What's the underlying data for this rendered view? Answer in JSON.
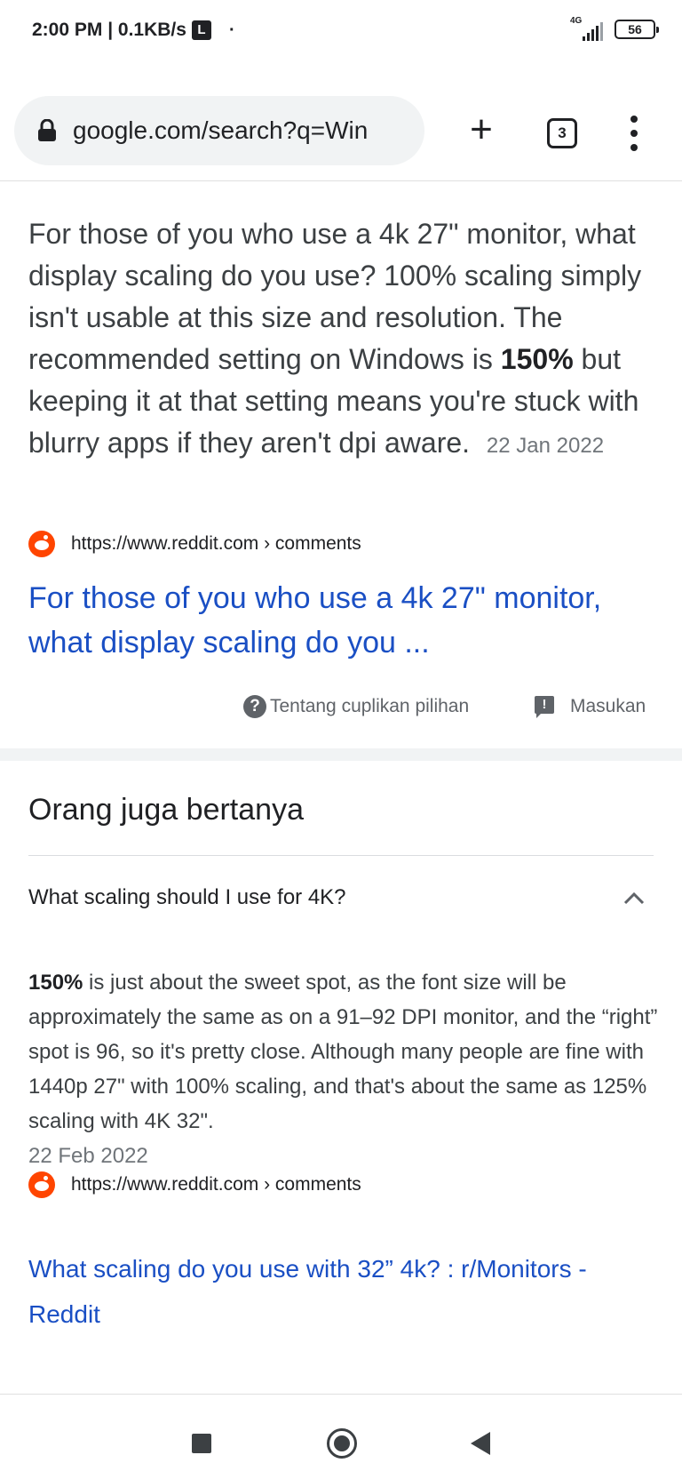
{
  "status_bar": {
    "time_speed": "2:00 PM | 0.1KB/s",
    "l_badge": "L",
    "dot": "·",
    "network": "4G",
    "battery": "56"
  },
  "browser": {
    "url": "google.com/search?q=Win",
    "plus": "+",
    "tab_count": "3"
  },
  "snippet": {
    "text_before": "For those of you who use a 4k 27\" monitor, what display scaling do you use? 100% scaling simply isn't usable at this size and resolution. The recommended setting on Windows is ",
    "bold": "150%",
    "text_after": " but keeping it at that setting means you're stuck with blurry apps if they aren't dpi aware.",
    "date": "22 Jan 2022"
  },
  "result1": {
    "source": "https://www.reddit.com › comments",
    "title": "For those of you who use a 4k 27\" monitor, what display scaling do you ..."
  },
  "feedback": {
    "about_label": "Tentang cuplikan pilihan",
    "feedback_label": "Masukan"
  },
  "paa": {
    "title": "Orang juga bertanya",
    "question": "What scaling should I use for 4K?",
    "answer_bold": "150%",
    "answer_text": " is just about the sweet spot, as the font size will be approximately the same as on a 91–92 DPI monitor, and the “right” spot is 96, so it's pretty close. Although many people are fine with 1440p 27\" with 100% scaling, and that's about the same as 125% scaling with 4K 32\".",
    "answer_date": "22 Feb 2022",
    "source": "https://www.reddit.com › comments",
    "link_title": "What scaling do you use with 32” 4k? : r/Monitors - Reddit"
  }
}
